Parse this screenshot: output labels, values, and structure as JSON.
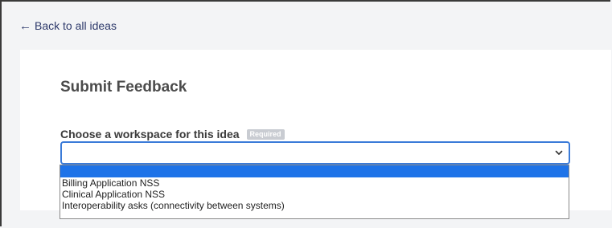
{
  "nav": {
    "back_label": "Back to all ideas"
  },
  "form": {
    "title": "Submit Feedback",
    "workspace_label": "Choose a workspace for this idea",
    "required_badge": "Required",
    "selected_value": ""
  },
  "dropdown": {
    "options": [
      "",
      "Billing Application NSS",
      "Clinical Application NSS",
      "Interoperability asks (connectivity between systems)"
    ]
  },
  "colors": {
    "accent": "#1e73e8",
    "focus_border": "#3b7bd8",
    "link": "#2e3a6b"
  }
}
